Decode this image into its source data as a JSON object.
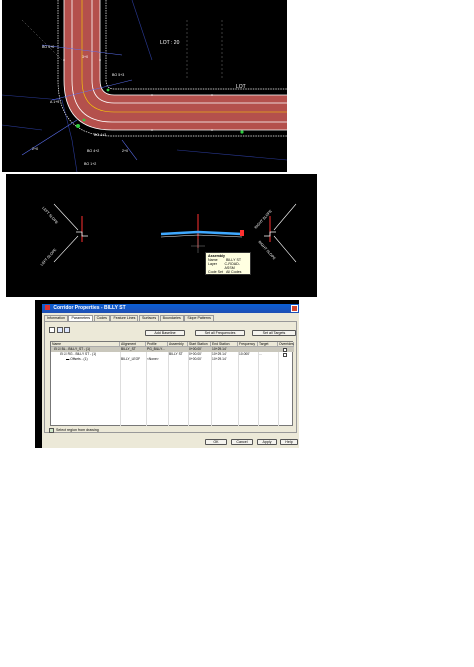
{
  "plan_view": {
    "lot_label": "LOT : 20",
    "lot_label_2": "LOT",
    "station_labels": [
      "BO 5+0",
      "3+0",
      "BO 5+3",
      "A 1+9",
      "BO 4+3",
      "2+0",
      "BO 4+2",
      "BO 1+2",
      "2+0"
    ]
  },
  "section_view": {
    "left_slope_label_top": "LEFT SLOPE",
    "left_slope_label_bottom": "LEFT SLOPE",
    "right_slope_label_top": "RIGHT SLOPE",
    "right_slope_label_bottom": "RIGHT SLOPE",
    "tooltip": {
      "title": "Assembly",
      "rows": [
        {
          "key": "Name",
          "value": "BILLY ST"
        },
        {
          "key": "Layer",
          "value": "C-ROAD-ASSM"
        },
        {
          "key": "Code Set Style",
          "value": "All Codes"
        }
      ]
    }
  },
  "dialog": {
    "title": "Corridor Properties - BILLY ST",
    "tabs": [
      "Information",
      "Parameters",
      "Codes",
      "Feature Lines",
      "Surfaces",
      "Boundaries",
      "Slope Patterns"
    ],
    "active_tab": "Parameters",
    "buttons": {
      "add_baseline": "Add Baseline",
      "set_all_frequencies": "Set all Frequencies",
      "set_all_targets": "Set all Targets",
      "ok": "OK",
      "cancel": "Cancel",
      "apply": "Apply",
      "help": "Help"
    },
    "columns": [
      "Name",
      "Alignment",
      "Profile",
      "Assembly",
      "Start Station",
      "End Station",
      "Frequency",
      "Target",
      "Overrides"
    ],
    "rows": [
      {
        "name": "BL - BILLY_ST - (1)",
        "alignment": "BILLY_ST",
        "profile": "PG_BILLY...",
        "assembly": "",
        "start": "0+00.00'",
        "end": "10+29.14'",
        "frequency": "",
        "target": "",
        "overrides": ""
      },
      {
        "name": "RG - BILLY ST - (1)",
        "alignment": "",
        "profile": "",
        "assembly": "BILLY ST",
        "start": "0+00.00'",
        "end": "10+29.14'",
        "frequency": "10.000'",
        "target": "...",
        "overrides": ""
      },
      {
        "name": "Offsets - (1)",
        "alignment": "BILLY_LEOF",
        "profile": "<None>",
        "assembly": "",
        "start": "0+00.00'",
        "end": "10+29.14'",
        "frequency": "",
        "target": "",
        "overrides": ""
      }
    ],
    "footer_label": "Select region from drawing",
    "accent_color": "#0a5fd6"
  }
}
